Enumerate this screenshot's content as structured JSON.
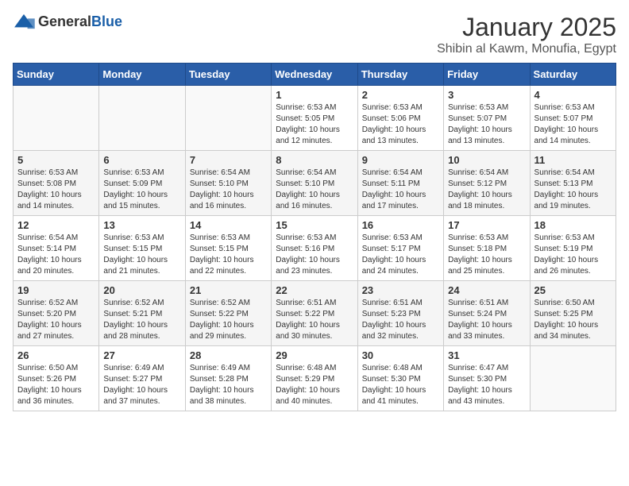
{
  "logo": {
    "general": "General",
    "blue": "Blue"
  },
  "title": "January 2025",
  "subtitle": "Shibin al Kawm, Monufia, Egypt",
  "weekdays": [
    "Sunday",
    "Monday",
    "Tuesday",
    "Wednesday",
    "Thursday",
    "Friday",
    "Saturday"
  ],
  "weeks": [
    [
      {
        "day": "",
        "info": ""
      },
      {
        "day": "",
        "info": ""
      },
      {
        "day": "",
        "info": ""
      },
      {
        "day": "1",
        "info": "Sunrise: 6:53 AM\nSunset: 5:05 PM\nDaylight: 10 hours\nand 12 minutes."
      },
      {
        "day": "2",
        "info": "Sunrise: 6:53 AM\nSunset: 5:06 PM\nDaylight: 10 hours\nand 13 minutes."
      },
      {
        "day": "3",
        "info": "Sunrise: 6:53 AM\nSunset: 5:07 PM\nDaylight: 10 hours\nand 13 minutes."
      },
      {
        "day": "4",
        "info": "Sunrise: 6:53 AM\nSunset: 5:07 PM\nDaylight: 10 hours\nand 14 minutes."
      }
    ],
    [
      {
        "day": "5",
        "info": "Sunrise: 6:53 AM\nSunset: 5:08 PM\nDaylight: 10 hours\nand 14 minutes."
      },
      {
        "day": "6",
        "info": "Sunrise: 6:53 AM\nSunset: 5:09 PM\nDaylight: 10 hours\nand 15 minutes."
      },
      {
        "day": "7",
        "info": "Sunrise: 6:54 AM\nSunset: 5:10 PM\nDaylight: 10 hours\nand 16 minutes."
      },
      {
        "day": "8",
        "info": "Sunrise: 6:54 AM\nSunset: 5:10 PM\nDaylight: 10 hours\nand 16 minutes."
      },
      {
        "day": "9",
        "info": "Sunrise: 6:54 AM\nSunset: 5:11 PM\nDaylight: 10 hours\nand 17 minutes."
      },
      {
        "day": "10",
        "info": "Sunrise: 6:54 AM\nSunset: 5:12 PM\nDaylight: 10 hours\nand 18 minutes."
      },
      {
        "day": "11",
        "info": "Sunrise: 6:54 AM\nSunset: 5:13 PM\nDaylight: 10 hours\nand 19 minutes."
      }
    ],
    [
      {
        "day": "12",
        "info": "Sunrise: 6:54 AM\nSunset: 5:14 PM\nDaylight: 10 hours\nand 20 minutes."
      },
      {
        "day": "13",
        "info": "Sunrise: 6:53 AM\nSunset: 5:15 PM\nDaylight: 10 hours\nand 21 minutes."
      },
      {
        "day": "14",
        "info": "Sunrise: 6:53 AM\nSunset: 5:15 PM\nDaylight: 10 hours\nand 22 minutes."
      },
      {
        "day": "15",
        "info": "Sunrise: 6:53 AM\nSunset: 5:16 PM\nDaylight: 10 hours\nand 23 minutes."
      },
      {
        "day": "16",
        "info": "Sunrise: 6:53 AM\nSunset: 5:17 PM\nDaylight: 10 hours\nand 24 minutes."
      },
      {
        "day": "17",
        "info": "Sunrise: 6:53 AM\nSunset: 5:18 PM\nDaylight: 10 hours\nand 25 minutes."
      },
      {
        "day": "18",
        "info": "Sunrise: 6:53 AM\nSunset: 5:19 PM\nDaylight: 10 hours\nand 26 minutes."
      }
    ],
    [
      {
        "day": "19",
        "info": "Sunrise: 6:52 AM\nSunset: 5:20 PM\nDaylight: 10 hours\nand 27 minutes."
      },
      {
        "day": "20",
        "info": "Sunrise: 6:52 AM\nSunset: 5:21 PM\nDaylight: 10 hours\nand 28 minutes."
      },
      {
        "day": "21",
        "info": "Sunrise: 6:52 AM\nSunset: 5:22 PM\nDaylight: 10 hours\nand 29 minutes."
      },
      {
        "day": "22",
        "info": "Sunrise: 6:51 AM\nSunset: 5:22 PM\nDaylight: 10 hours\nand 30 minutes."
      },
      {
        "day": "23",
        "info": "Sunrise: 6:51 AM\nSunset: 5:23 PM\nDaylight: 10 hours\nand 32 minutes."
      },
      {
        "day": "24",
        "info": "Sunrise: 6:51 AM\nSunset: 5:24 PM\nDaylight: 10 hours\nand 33 minutes."
      },
      {
        "day": "25",
        "info": "Sunrise: 6:50 AM\nSunset: 5:25 PM\nDaylight: 10 hours\nand 34 minutes."
      }
    ],
    [
      {
        "day": "26",
        "info": "Sunrise: 6:50 AM\nSunset: 5:26 PM\nDaylight: 10 hours\nand 36 minutes."
      },
      {
        "day": "27",
        "info": "Sunrise: 6:49 AM\nSunset: 5:27 PM\nDaylight: 10 hours\nand 37 minutes."
      },
      {
        "day": "28",
        "info": "Sunrise: 6:49 AM\nSunset: 5:28 PM\nDaylight: 10 hours\nand 38 minutes."
      },
      {
        "day": "29",
        "info": "Sunrise: 6:48 AM\nSunset: 5:29 PM\nDaylight: 10 hours\nand 40 minutes."
      },
      {
        "day": "30",
        "info": "Sunrise: 6:48 AM\nSunset: 5:30 PM\nDaylight: 10 hours\nand 41 minutes."
      },
      {
        "day": "31",
        "info": "Sunrise: 6:47 AM\nSunset: 5:30 PM\nDaylight: 10 hours\nand 43 minutes."
      },
      {
        "day": "",
        "info": ""
      }
    ]
  ]
}
